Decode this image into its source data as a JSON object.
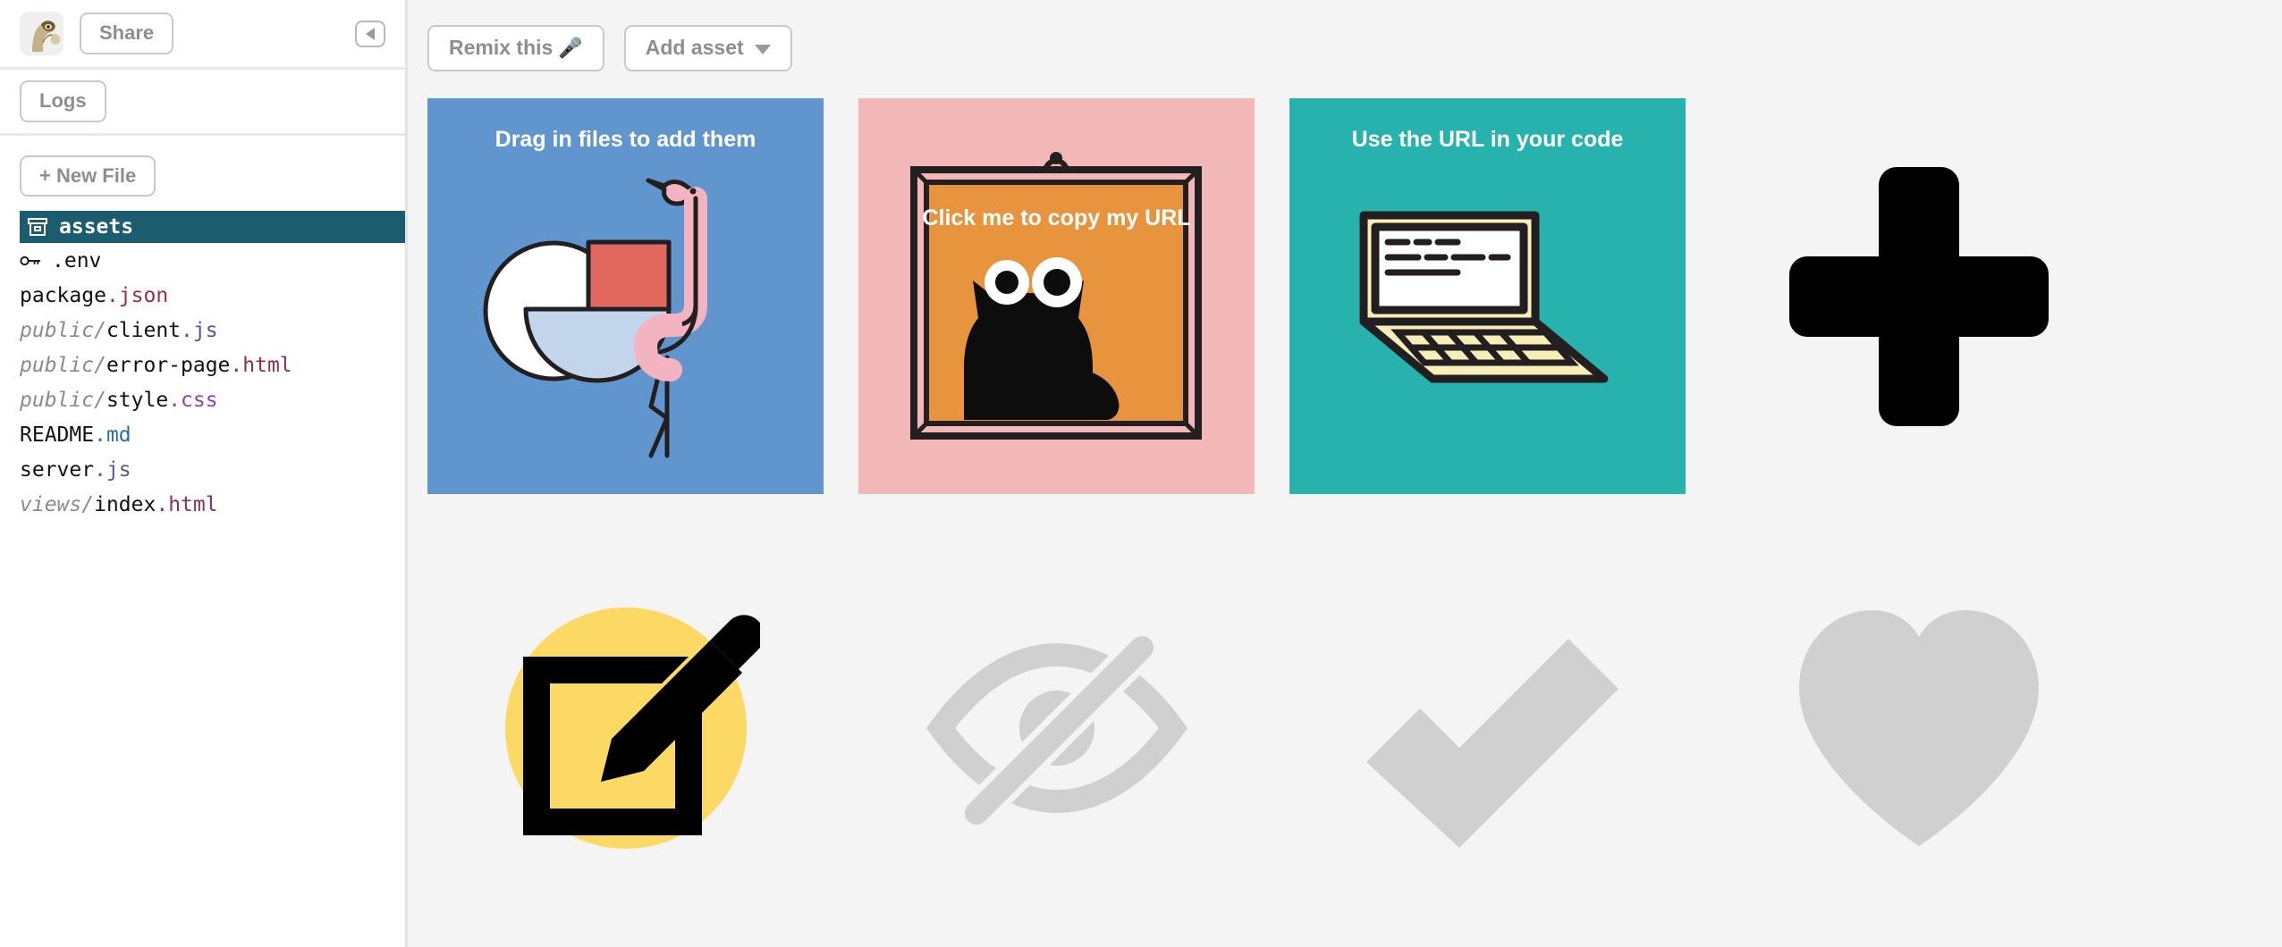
{
  "sidebar": {
    "avatar_name": "dinosaur-avatar",
    "share_label": "Share",
    "collapse_icon": "triangle-left-icon",
    "logs_label": "Logs",
    "new_file_label": "+ New File",
    "files": [
      {
        "icon": "archive-box-icon",
        "dir": "",
        "base": "assets",
        "ext": "",
        "ext_class": "",
        "selected": true
      },
      {
        "icon": "key-icon",
        "dir": "",
        "base": ".env",
        "ext": "",
        "ext_class": "",
        "selected": false
      },
      {
        "icon": "",
        "dir": "",
        "base": "package",
        "ext": ".json",
        "ext_class": "ext-json",
        "selected": false
      },
      {
        "icon": "",
        "dir": "public/",
        "base": "client",
        "ext": ".js",
        "ext_class": "ext-js",
        "selected": false
      },
      {
        "icon": "",
        "dir": "public/",
        "base": "error-page",
        "ext": ".html",
        "ext_class": "ext-html",
        "selected": false
      },
      {
        "icon": "",
        "dir": "public/",
        "base": "style",
        "ext": ".css",
        "ext_class": "ext-css",
        "selected": false
      },
      {
        "icon": "",
        "dir": "",
        "base": "README",
        "ext": ".md",
        "ext_class": "ext-md",
        "selected": false
      },
      {
        "icon": "",
        "dir": "",
        "base": "server",
        "ext": ".js",
        "ext_class": "ext-js",
        "selected": false
      },
      {
        "icon": "",
        "dir": "views/",
        "base": "index",
        "ext": ".html",
        "ext_class": "ext-html",
        "selected": false
      }
    ]
  },
  "toolbar": {
    "remix_label": "Remix this",
    "remix_emoji": "🎤",
    "add_asset_label": "Add asset",
    "add_asset_chevron": "chevron-down-icon"
  },
  "assets": {
    "row1": [
      {
        "name": "asset-drag-in-files",
        "title": "Drag in files to add them",
        "bg": "#6195ce",
        "art": "flamingo-illustration"
      },
      {
        "name": "asset-click-to-copy-url",
        "title": "Click me to copy my URL",
        "bg": "#f2b7b7",
        "art": "framed-cat-illustration",
        "inner_bg": "#e8943f"
      },
      {
        "name": "asset-use-url-in-code",
        "title": "Use the URL in your code",
        "bg": "#28b2ae",
        "art": "laptop-illustration"
      },
      {
        "name": "asset-plus-icon",
        "title": "",
        "bg": "#f4f4f4",
        "art": "plus-icon",
        "art_color": "#000000"
      }
    ],
    "row2": [
      {
        "name": "asset-edit-icon",
        "title": "",
        "bg": "#f4f4f4",
        "art": "edit-pencil-icon",
        "art_color": "#000000",
        "circle_color": "#fcd965"
      },
      {
        "name": "asset-eye-off-icon",
        "title": "",
        "bg": "#f4f4f4",
        "art": "eye-off-icon",
        "art_color": "#d0d0d0"
      },
      {
        "name": "asset-check-icon",
        "title": "",
        "bg": "#f4f4f4",
        "art": "checkmark-icon",
        "art_color": "#d0d0d0"
      },
      {
        "name": "asset-heart-icon",
        "title": "",
        "bg": "#f4f4f4",
        "art": "heart-icon",
        "art_color": "#d0d0d0"
      }
    ]
  },
  "colors": {
    "selected_file_bg": "#1b5c6e",
    "main_bg": "#f4f4f4",
    "sidebar_bg": "#ffffff",
    "muted_text": "#8e8e8e"
  }
}
